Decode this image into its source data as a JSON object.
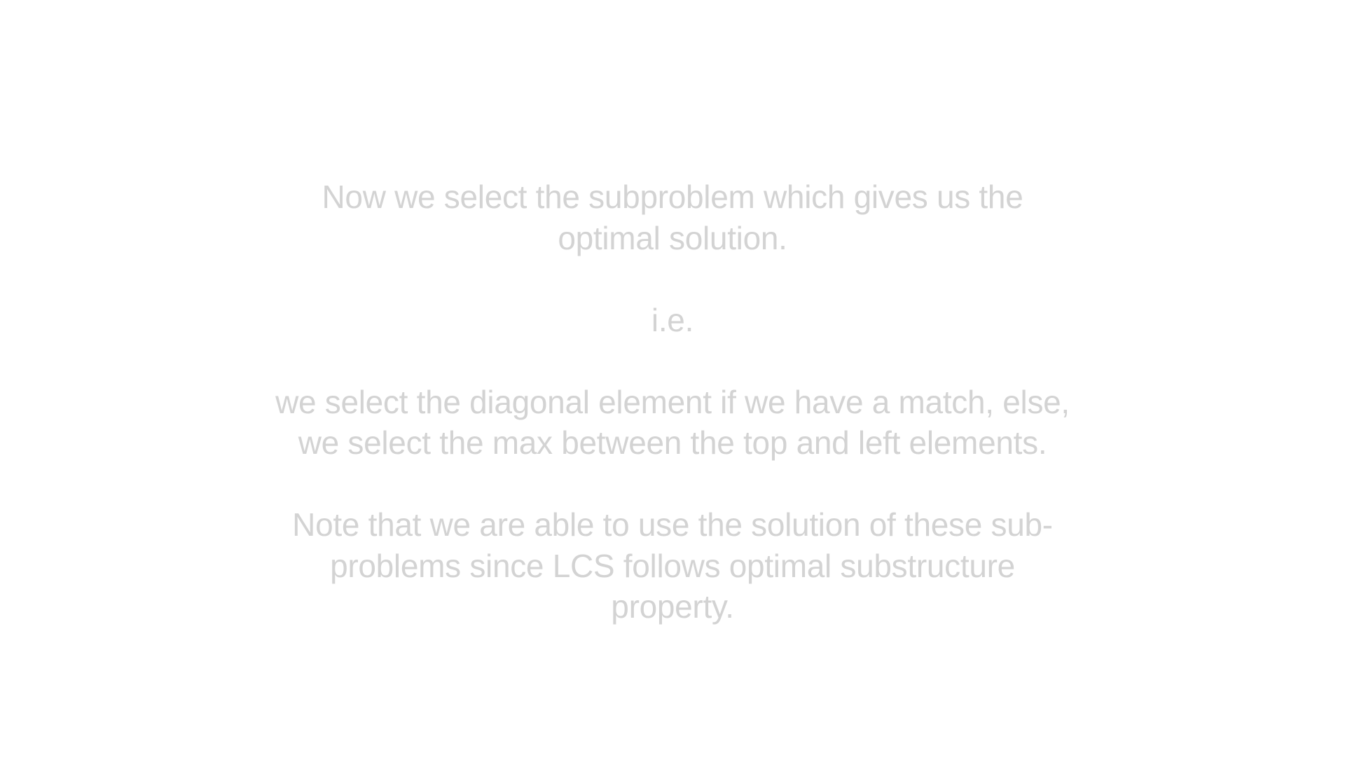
{
  "slide": {
    "paragraph_1": {
      "lines": [
        "Now we select the subproblem which gives us the",
        "optimal solution."
      ]
    },
    "paragraph_2": {
      "lines": [
        "i.e."
      ]
    },
    "paragraph_3": {
      "lines": [
        "we select the diagonal element if we have a match, else,",
        "we select the max between the top and left elements."
      ]
    },
    "paragraph_4": {
      "lines": [
        "Note that we are able to use the solution of these sub-",
        "problems since LCS follows optimal substructure",
        "property."
      ]
    },
    "text_color": "#d3d3d3",
    "background_color": "#ffffff"
  }
}
